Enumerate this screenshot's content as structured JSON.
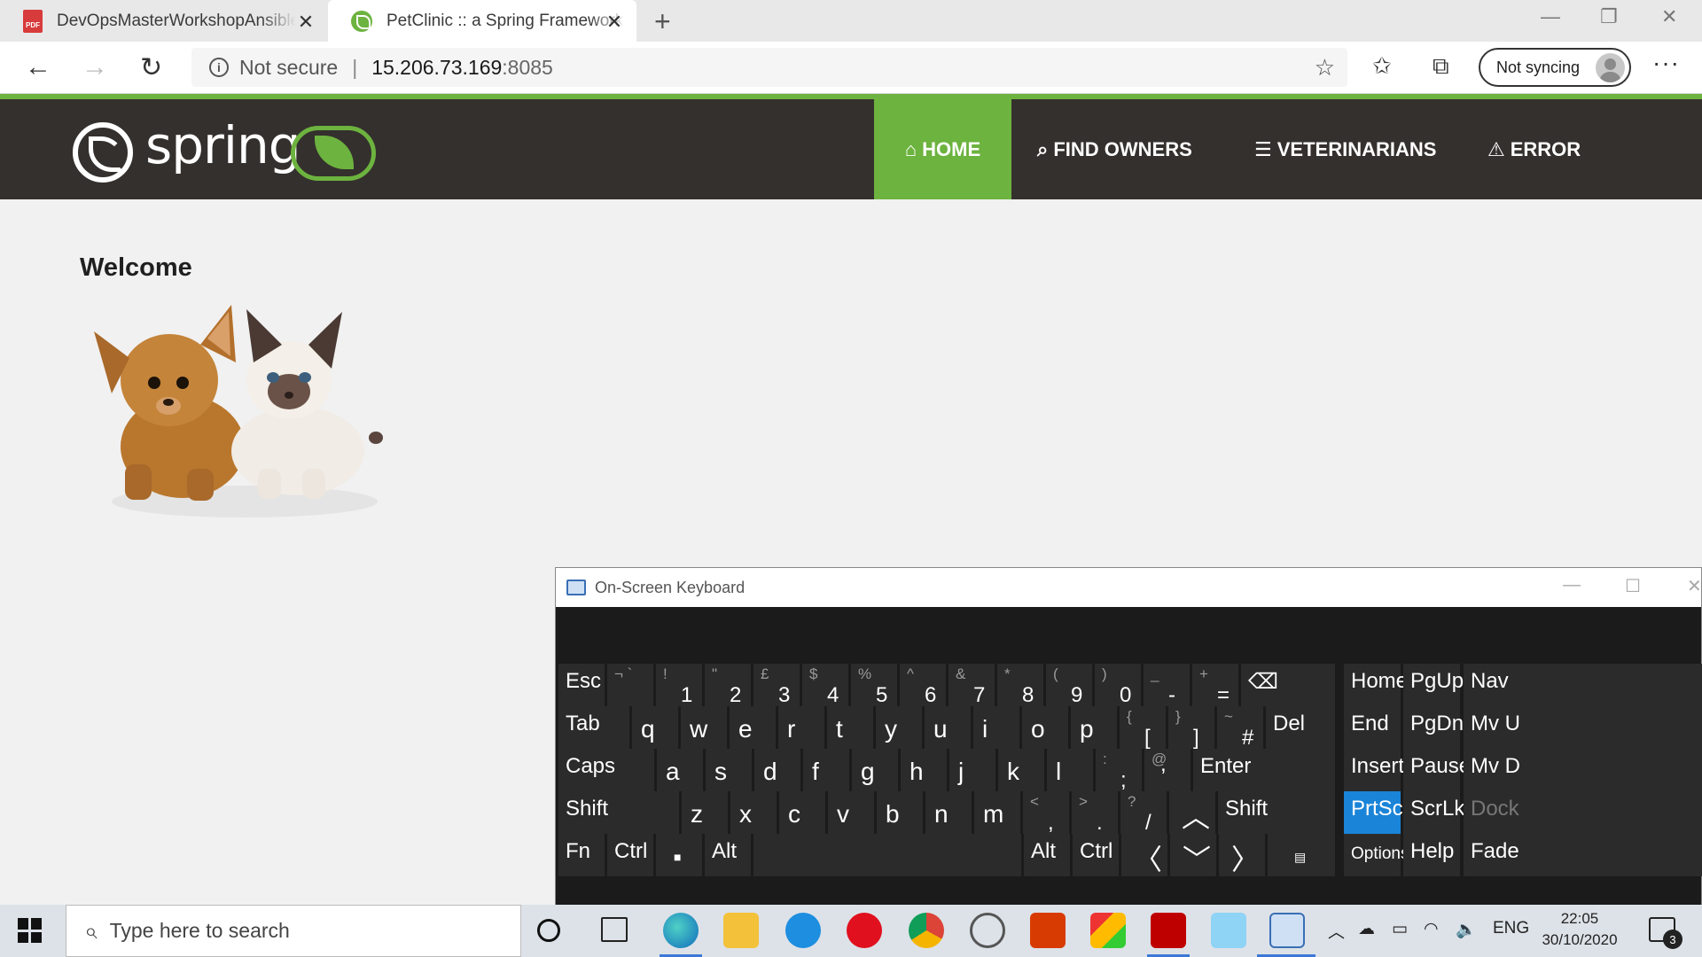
{
  "browser": {
    "tabs": [
      {
        "label": "DevOpsMasterWorkshopAnsible",
        "active": false,
        "icon": "pdf-icon"
      },
      {
        "label": "PetClinic :: a Spring Framework d",
        "active": true,
        "icon": "spring-leaf-icon"
      }
    ],
    "close_symbol": "✕",
    "new_tab_symbol": "+",
    "address": {
      "security_label": "Not secure",
      "host": "15.206.73.169",
      "port": ":8085"
    },
    "sync_label": "Not syncing"
  },
  "app": {
    "logo_text": "spring",
    "nav": [
      {
        "label": "HOME",
        "icon": "home-icon",
        "active": true
      },
      {
        "label": "FIND OWNERS",
        "icon": "search-icon",
        "active": false
      },
      {
        "label": "VETERINARIANS",
        "icon": "list-icon",
        "active": false
      },
      {
        "label": "ERROR",
        "icon": "warning-icon",
        "active": false
      }
    ],
    "welcome": "Welcome",
    "accent_color": "#6db33f",
    "header_color": "#34302d"
  },
  "osk": {
    "title": "On-Screen Keyboard",
    "rows": {
      "r1": [
        "Esc",
        "1",
        "2",
        "3",
        "4",
        "5",
        "6",
        "7",
        "8",
        "9",
        "0",
        "-",
        "="
      ],
      "r1_shift": [
        "¬ `",
        "!",
        "\"",
        "£",
        "$",
        "%",
        "^",
        "&",
        "*",
        "(",
        ")",
        "_",
        "+"
      ],
      "r2": [
        "Tab",
        "q",
        "w",
        "e",
        "r",
        "t",
        "y",
        "u",
        "i",
        "o",
        "p",
        "[",
        "]",
        "#",
        "Del"
      ],
      "r2_shift": [
        "{",
        "}",
        "~"
      ],
      "r3": [
        "Caps",
        "a",
        "s",
        "d",
        "f",
        "g",
        "h",
        "j",
        "k",
        "l",
        ";",
        ",",
        "Enter"
      ],
      "r3_shift": [
        ":",
        "@"
      ],
      "r4": [
        "Shift",
        "z",
        "x",
        "c",
        "v",
        "b",
        "n",
        "m",
        ",",
        ".",
        "/",
        "Shift"
      ],
      "r4_shift": [
        "<",
        ">",
        "?"
      ],
      "r5": [
        "Fn",
        "Ctrl",
        "Alt",
        "Alt",
        "Ctrl"
      ]
    },
    "side": {
      "col1": [
        "Home",
        "End",
        "Insert",
        "PrtScn",
        "Options"
      ],
      "col2": [
        "PgUp",
        "PgDn",
        "Pause",
        "ScrLk",
        "Help"
      ],
      "col3": [
        "Nav",
        "Mv U",
        "Mv D",
        "Dock",
        "Fade"
      ]
    },
    "highlight_color": "#1a84d8"
  },
  "taskbar": {
    "search_placeholder": "Type here to search",
    "language": "ENG",
    "time": "22:05",
    "date": "30/10/2020",
    "notification_count": "3"
  }
}
